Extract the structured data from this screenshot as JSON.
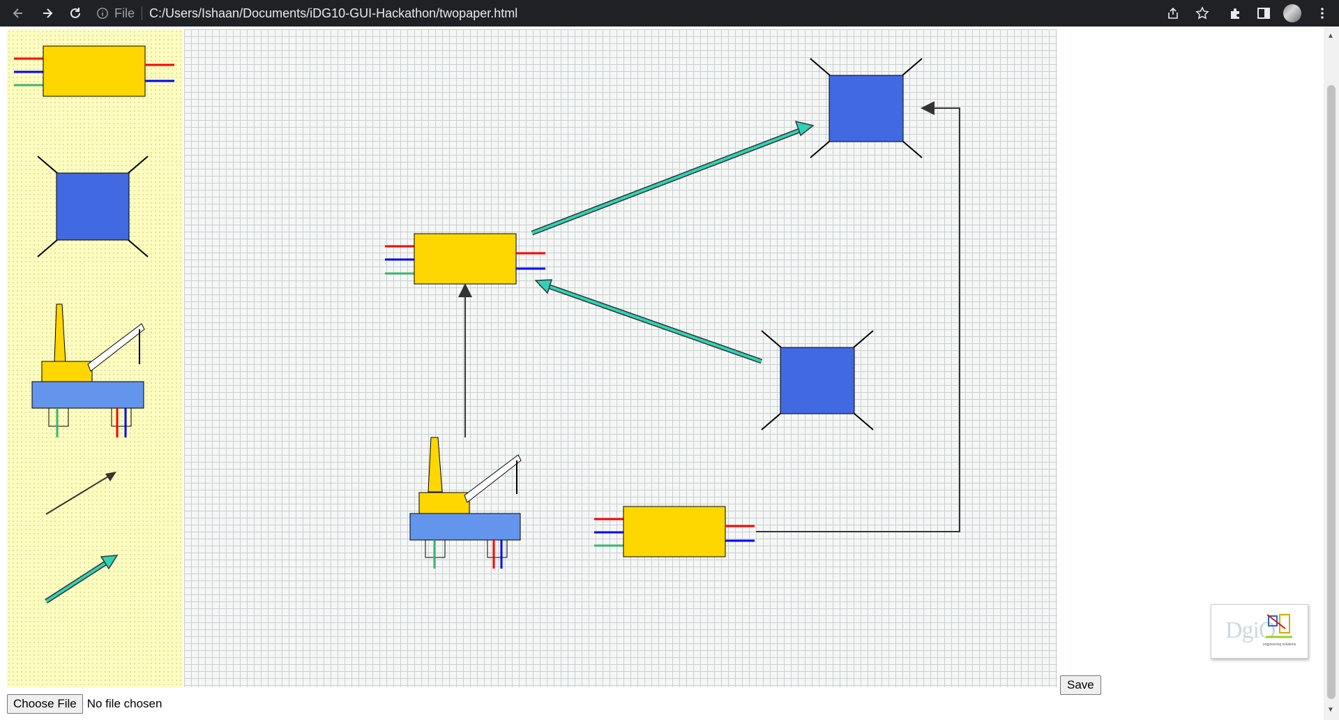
{
  "browser": {
    "url_scheme_label": "File",
    "url": "C:/Users/Ishaan/Documents/iDG10-GUI-Hackathon/twopaper.html",
    "icons": [
      "back-arrow-icon",
      "forward-arrow-icon",
      "reload-icon",
      "info-icon",
      "share-icon",
      "bookmark-star-icon",
      "extensions-puzzle-icon",
      "side-panel-icon",
      "profile-avatar",
      "menu-kebab-icon"
    ]
  },
  "palette": {
    "items": [
      "yellow-connector-module",
      "blue-square-node",
      "offshore-rig",
      "black-arrow",
      "teal-arrow"
    ]
  },
  "canvas": {
    "components": [
      "yellow-connector-module",
      "yellow-connector-module",
      "blue-square-node",
      "blue-square-node",
      "offshore-rig"
    ],
    "connectors": [
      "teal-arrow",
      "teal-arrow",
      "black-arrow",
      "black-elbow-arrow"
    ]
  },
  "colors": {
    "module_fill": "#FFD700",
    "node_fill": "#4169E1",
    "rig_platform": "#6495ED",
    "teal_arrow": "#2ED3B7",
    "wire_red": "#FF0000",
    "wire_blue": "#0000FF",
    "wire_green": "#3CB371"
  },
  "file_input": {
    "button_label": "Choose File",
    "status_text": "No file chosen"
  },
  "save_label": "Save",
  "logo": {
    "text": "DgiO",
    "subtitle": "engineering solutions"
  }
}
